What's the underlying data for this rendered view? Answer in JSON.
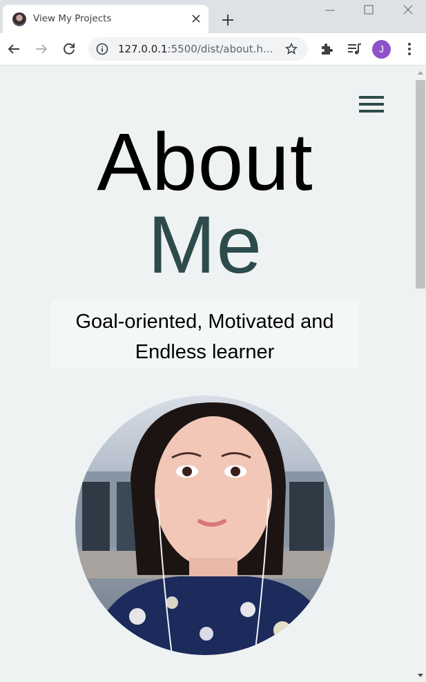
{
  "browser": {
    "tab_title": "View My Projects",
    "url_host": "127.0.0.1",
    "url_rest": ":5500/dist/about.h...",
    "profile_initial": "J"
  },
  "page": {
    "title_line1": "About",
    "title_line2": "Me",
    "tagline": "Goal-oriented, Motivated and Endless learner",
    "accent_color": "#2d4b4b",
    "background_color": "#eef2f3"
  }
}
